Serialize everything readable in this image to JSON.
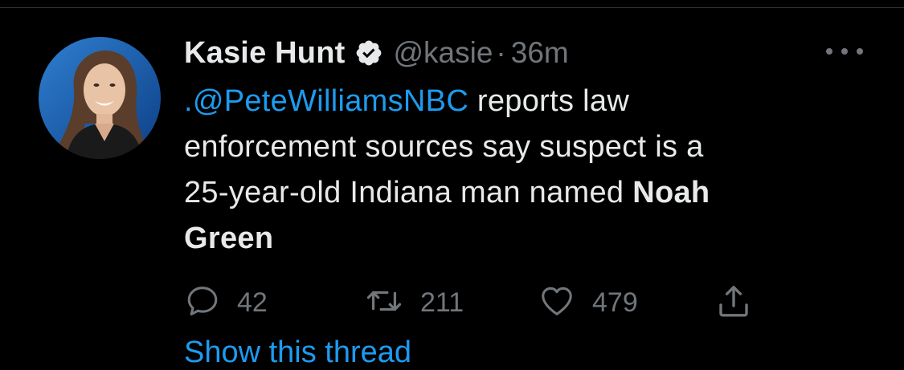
{
  "author": {
    "name": "Kasie Hunt",
    "handle": "@kasie",
    "separator": "·",
    "time": "36m",
    "verified": true
  },
  "tweet": {
    "lines": [
      [
        {
          "t": ".@PeteWilliamsNBC",
          "kind": "mention"
        },
        {
          "t": " reports law",
          "kind": "text"
        }
      ],
      [
        {
          "t": "enforcement sources say suspect is a",
          "kind": "text"
        }
      ],
      [
        {
          "t": "25-year-old Indiana man named ",
          "kind": "text"
        },
        {
          "t": "Noah",
          "kind": "bold"
        }
      ],
      [
        {
          "t": "Green",
          "kind": "bold"
        }
      ]
    ]
  },
  "actions": {
    "replies": "42",
    "retweets": "211",
    "likes": "479"
  },
  "show_thread": "Show this thread",
  "colors": {
    "background": "#000000",
    "text": "#e7e9ea",
    "secondary": "#71767b",
    "link": "#1d9bf0"
  },
  "icons": {
    "reply": "speech-bubble-icon",
    "retweet": "retweet-icon",
    "like": "heart-icon",
    "share": "share-upload-icon",
    "more": "ellipsis-icon",
    "verified": "verified-badge-icon"
  }
}
